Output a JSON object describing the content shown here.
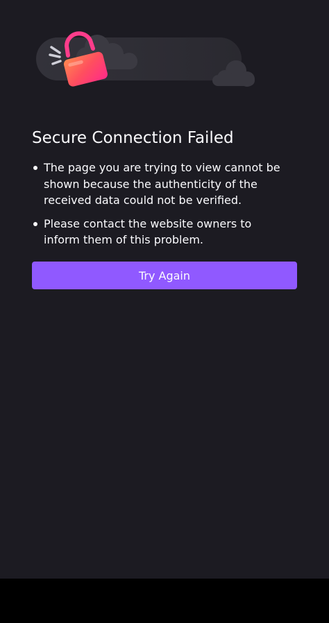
{
  "illustration": {
    "icon": "broken-lock-illustration",
    "colors": {
      "lock_body_start": "#ff4f5e",
      "lock_body_end": "#ff2a8a",
      "shackle": "#ff3d8b",
      "cloud": "#38373f",
      "cloud_band": "#2b2a33"
    }
  },
  "error": {
    "title": "Secure Connection Failed",
    "reasons": [
      "The page you are trying to view cannot be shown because the authenticity of the received data could not be verified.",
      "Please contact the website owners to inform them of this problem."
    ]
  },
  "actions": {
    "try_again_label": "Try Again"
  },
  "theme": {
    "background": "#1c1b22",
    "text": "#fbfbfe",
    "accent": "#9059ff"
  }
}
